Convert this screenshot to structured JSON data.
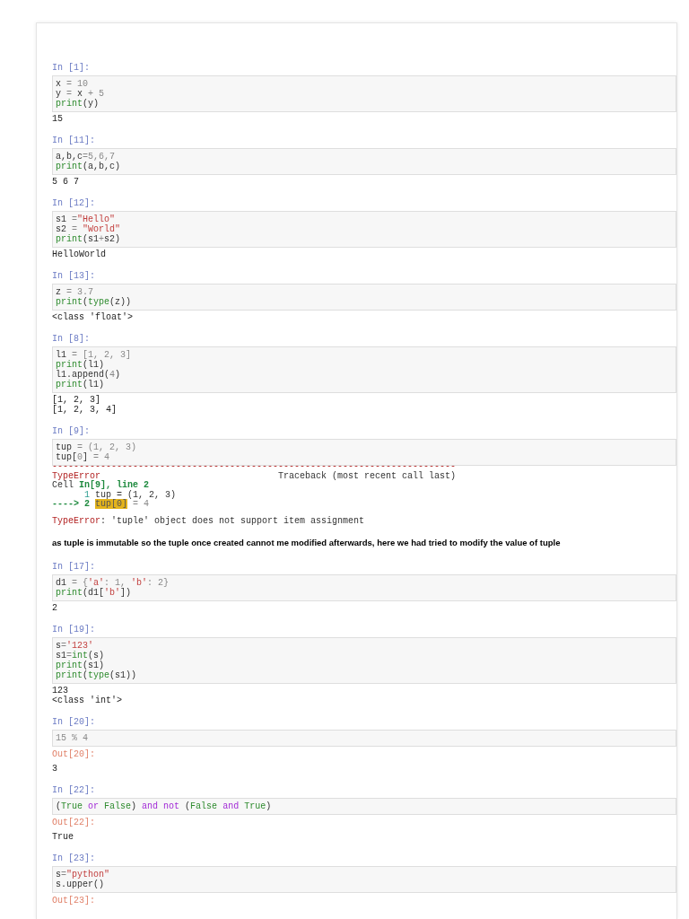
{
  "cells": [
    {
      "kind": "code",
      "prompt": "In [1]:",
      "code": [
        [
          {
            "text": "x",
            "kind": "plain"
          },
          {
            "text": " = 10",
            "kind": "op"
          }
        ],
        [
          {
            "text": "y",
            "kind": "plain"
          },
          {
            "text": " = ",
            "kind": "op"
          },
          {
            "text": "x",
            "kind": "plain"
          },
          {
            "text": " + 5",
            "kind": "op"
          }
        ],
        [
          {
            "text": "print",
            "kind": "builtin"
          },
          {
            "text": "(y)",
            "kind": "plain"
          }
        ]
      ],
      "outputs": [
        {
          "kind": "stream",
          "lines": [
            "15"
          ]
        }
      ]
    },
    {
      "kind": "code",
      "prompt": "In [11]:",
      "code": [
        [
          {
            "text": "a,b,c",
            "kind": "plain"
          },
          {
            "text": "=5,6,7",
            "kind": "op"
          }
        ],
        [
          {
            "text": "print",
            "kind": "builtin"
          },
          {
            "text": "(a,b,c)",
            "kind": "plain"
          }
        ]
      ],
      "outputs": [
        {
          "kind": "stream",
          "lines": [
            "5 6 7"
          ]
        }
      ]
    },
    {
      "kind": "code",
      "prompt": "In [12]:",
      "code": [
        [
          {
            "text": "s1 ",
            "kind": "plain"
          },
          {
            "text": "=",
            "kind": "op"
          },
          {
            "text": "\"Hello\"",
            "kind": "string"
          }
        ],
        [
          {
            "text": "s2 ",
            "kind": "plain"
          },
          {
            "text": "= ",
            "kind": "op"
          },
          {
            "text": "\"World\"",
            "kind": "string"
          }
        ],
        [
          {
            "text": "print",
            "kind": "builtin"
          },
          {
            "text": "(s1",
            "kind": "plain"
          },
          {
            "text": "+",
            "kind": "op"
          },
          {
            "text": "s2)",
            "kind": "plain"
          }
        ]
      ],
      "outputs": [
        {
          "kind": "stream",
          "lines": [
            "HelloWorld"
          ]
        }
      ]
    },
    {
      "kind": "code",
      "prompt": "In [13]:",
      "code": [
        [
          {
            "text": "z",
            "kind": "plain"
          },
          {
            "text": " = 3.7",
            "kind": "op"
          }
        ],
        [
          {
            "text": "print",
            "kind": "builtin"
          },
          {
            "text": "(",
            "kind": "plain"
          },
          {
            "text": "type",
            "kind": "builtin"
          },
          {
            "text": "(z))",
            "kind": "plain"
          }
        ]
      ],
      "outputs": [
        {
          "kind": "stream",
          "lines": [
            "<class 'float'>"
          ]
        }
      ]
    },
    {
      "kind": "code",
      "prompt": "In [8]:",
      "code": [
        [
          {
            "text": "l1",
            "kind": "plain"
          },
          {
            "text": " = [1, 2, 3]",
            "kind": "op"
          }
        ],
        [
          {
            "text": "print",
            "kind": "builtin"
          },
          {
            "text": "(l1)",
            "kind": "plain"
          }
        ],
        [
          {
            "text": "l1.append(",
            "kind": "plain"
          },
          {
            "text": "4",
            "kind": "op"
          },
          {
            "text": ")",
            "kind": "plain"
          }
        ],
        [
          {
            "text": "print",
            "kind": "builtin"
          },
          {
            "text": "(l1)",
            "kind": "plain"
          }
        ]
      ],
      "outputs": [
        {
          "kind": "stream",
          "lines": [
            "[1, 2, 3]",
            "[1, 2, 3, 4]"
          ]
        }
      ]
    },
    {
      "kind": "code",
      "prompt": "In [9]:",
      "code": [
        [
          {
            "text": "tup",
            "kind": "plain"
          },
          {
            "text": " = (1, 2, 3)",
            "kind": "op"
          }
        ],
        [
          {
            "text": "tup[",
            "kind": "plain"
          },
          {
            "text": "0",
            "kind": "op"
          },
          {
            "text": "]",
            "kind": "plain"
          },
          {
            "text": " = 4",
            "kind": "op"
          }
        ]
      ],
      "outputs": [
        {
          "kind": "error",
          "traceback": [
            [
              {
                "text": "---------------------------------------------------------------------------",
                "kind": "error"
              }
            ],
            [
              {
                "text": "TypeError",
                "kind": "error"
              },
              {
                "text": "                                 Traceback (most recent call last)",
                "kind": "plain"
              }
            ],
            [
              {
                "text": "Cell ",
                "kind": "plain"
              },
              {
                "text": "In[9], line 2",
                "kind": "green"
              }
            ],
            [
              {
                "text": "      1",
                "kind": "teal"
              },
              {
                "text": " tup = (1, 2, 3)",
                "kind": "plain"
              }
            ],
            [
              {
                "text": "----> 2 ",
                "kind": "green"
              },
              {
                "text": "tup[0]",
                "kind": "highlight"
              },
              {
                "text": " = 4",
                "kind": "op"
              }
            ]
          ],
          "message": [
            {
              "text": "TypeError",
              "kind": "error"
            },
            {
              "text": ": 'tuple' object does not support item assignment",
              "kind": "plain"
            }
          ]
        }
      ]
    },
    {
      "kind": "markdown",
      "text": "as tuple is immutable so the tuple once created cannot me modified afterwards, here we had tried to modify the value of tuple"
    },
    {
      "kind": "code",
      "prompt": "In [17]:",
      "code": [
        [
          {
            "text": "d1",
            "kind": "plain"
          },
          {
            "text": " = {",
            "kind": "op"
          },
          {
            "text": "'a'",
            "kind": "string"
          },
          {
            "text": ": 1, ",
            "kind": "op"
          },
          {
            "text": "'b'",
            "kind": "string"
          },
          {
            "text": ": 2}",
            "kind": "op"
          }
        ],
        [
          {
            "text": "print",
            "kind": "builtin"
          },
          {
            "text": "(d1[",
            "kind": "plain"
          },
          {
            "text": "'b'",
            "kind": "string"
          },
          {
            "text": "])",
            "kind": "plain"
          }
        ]
      ],
      "outputs": [
        {
          "kind": "stream",
          "lines": [
            "2"
          ]
        }
      ]
    },
    {
      "kind": "code",
      "prompt": "In [19]:",
      "code": [
        [
          {
            "text": "s",
            "kind": "plain"
          },
          {
            "text": "=",
            "kind": "op"
          },
          {
            "text": "'123'",
            "kind": "string"
          }
        ],
        [
          {
            "text": "s1",
            "kind": "plain"
          },
          {
            "text": "=",
            "kind": "op"
          },
          {
            "text": "int",
            "kind": "builtin"
          },
          {
            "text": "(s)",
            "kind": "plain"
          }
        ],
        [
          {
            "text": "print",
            "kind": "builtin"
          },
          {
            "text": "(s1)",
            "kind": "plain"
          }
        ],
        [
          {
            "text": "print",
            "kind": "builtin"
          },
          {
            "text": "(",
            "kind": "plain"
          },
          {
            "text": "type",
            "kind": "builtin"
          },
          {
            "text": "(s1))",
            "kind": "plain"
          }
        ]
      ],
      "outputs": [
        {
          "kind": "stream",
          "lines": [
            "123",
            "<class 'int'>"
          ]
        }
      ]
    },
    {
      "kind": "code",
      "prompt": "In [20]:",
      "code": [
        [
          {
            "text": "15 % 4",
            "kind": "op"
          }
        ]
      ],
      "outputs": [
        {
          "kind": "result",
          "prompt": "Out[20]:",
          "lines": [
            "3"
          ]
        }
      ]
    },
    {
      "kind": "code",
      "prompt": "In [22]:",
      "code": [
        [
          {
            "text": "(",
            "kind": "plain"
          },
          {
            "text": "True",
            "kind": "builtin"
          },
          {
            "text": " or ",
            "kind": "keyword"
          },
          {
            "text": "False",
            "kind": "builtin"
          },
          {
            "text": ") ",
            "kind": "plain"
          },
          {
            "text": "and not",
            "kind": "keyword"
          },
          {
            "text": " (",
            "kind": "plain"
          },
          {
            "text": "False",
            "kind": "builtin"
          },
          {
            "text": " and ",
            "kind": "keyword"
          },
          {
            "text": "True",
            "kind": "builtin"
          },
          {
            "text": ")",
            "kind": "plain"
          }
        ]
      ],
      "outputs": [
        {
          "kind": "result",
          "prompt": "Out[22]:",
          "lines": [
            "True"
          ]
        }
      ]
    },
    {
      "kind": "code",
      "prompt": "In [23]:",
      "code": [
        [
          {
            "text": "s",
            "kind": "plain"
          },
          {
            "text": "=",
            "kind": "op"
          },
          {
            "text": "\"python\"",
            "kind": "string"
          }
        ],
        [
          {
            "text": "s.upper()",
            "kind": "plain"
          }
        ]
      ],
      "outputs": [
        {
          "kind": "result",
          "prompt": "Out[23]:"
        }
      ]
    }
  ]
}
